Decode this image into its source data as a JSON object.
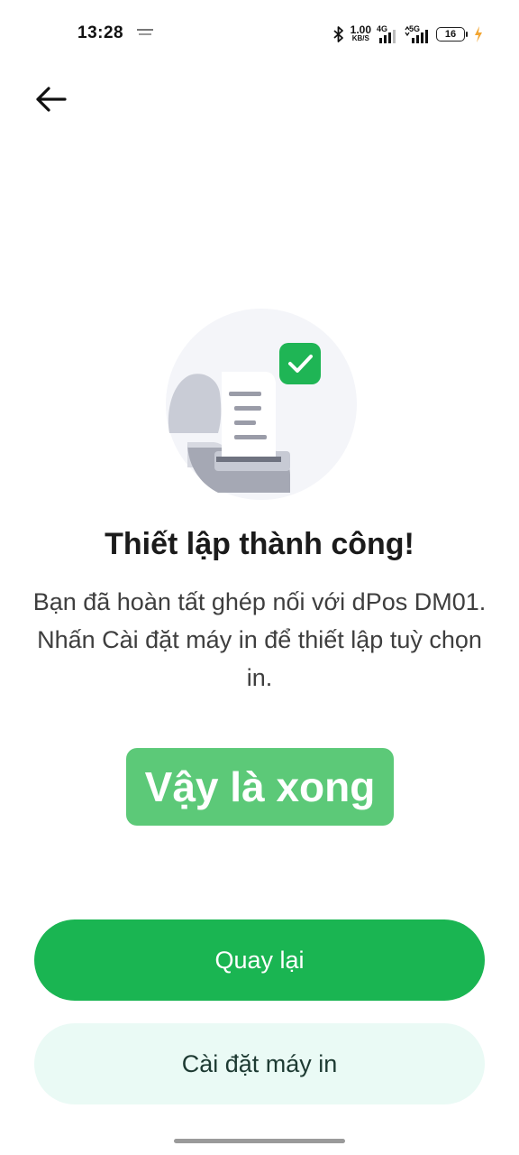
{
  "status_bar": {
    "time": "13:28",
    "net_speed_value": "1.00",
    "net_speed_unit": "KB/S",
    "network_1": "4G",
    "network_2": "5G",
    "battery": "16",
    "icons": [
      "bluetooth-icon",
      "signal-icon",
      "battery-icon",
      "charging-icon"
    ]
  },
  "header": {
    "back_icon": "arrow-left-icon"
  },
  "main": {
    "title": "Thiết lập thành công!",
    "description": "Bạn đã hoàn tất ghép nối với dPos DM01. Nhấn Cài đặt máy in để thiết lập tuỳ chọn in.",
    "badge": "Vậy là xong"
  },
  "actions": {
    "primary_label": "Quay lại",
    "secondary_label": "Cài đặt máy in"
  },
  "colors": {
    "primary": "#1ab552",
    "badge": "#5cc978",
    "secondary_bg": "#eafaf5",
    "check": "#1fb555"
  }
}
